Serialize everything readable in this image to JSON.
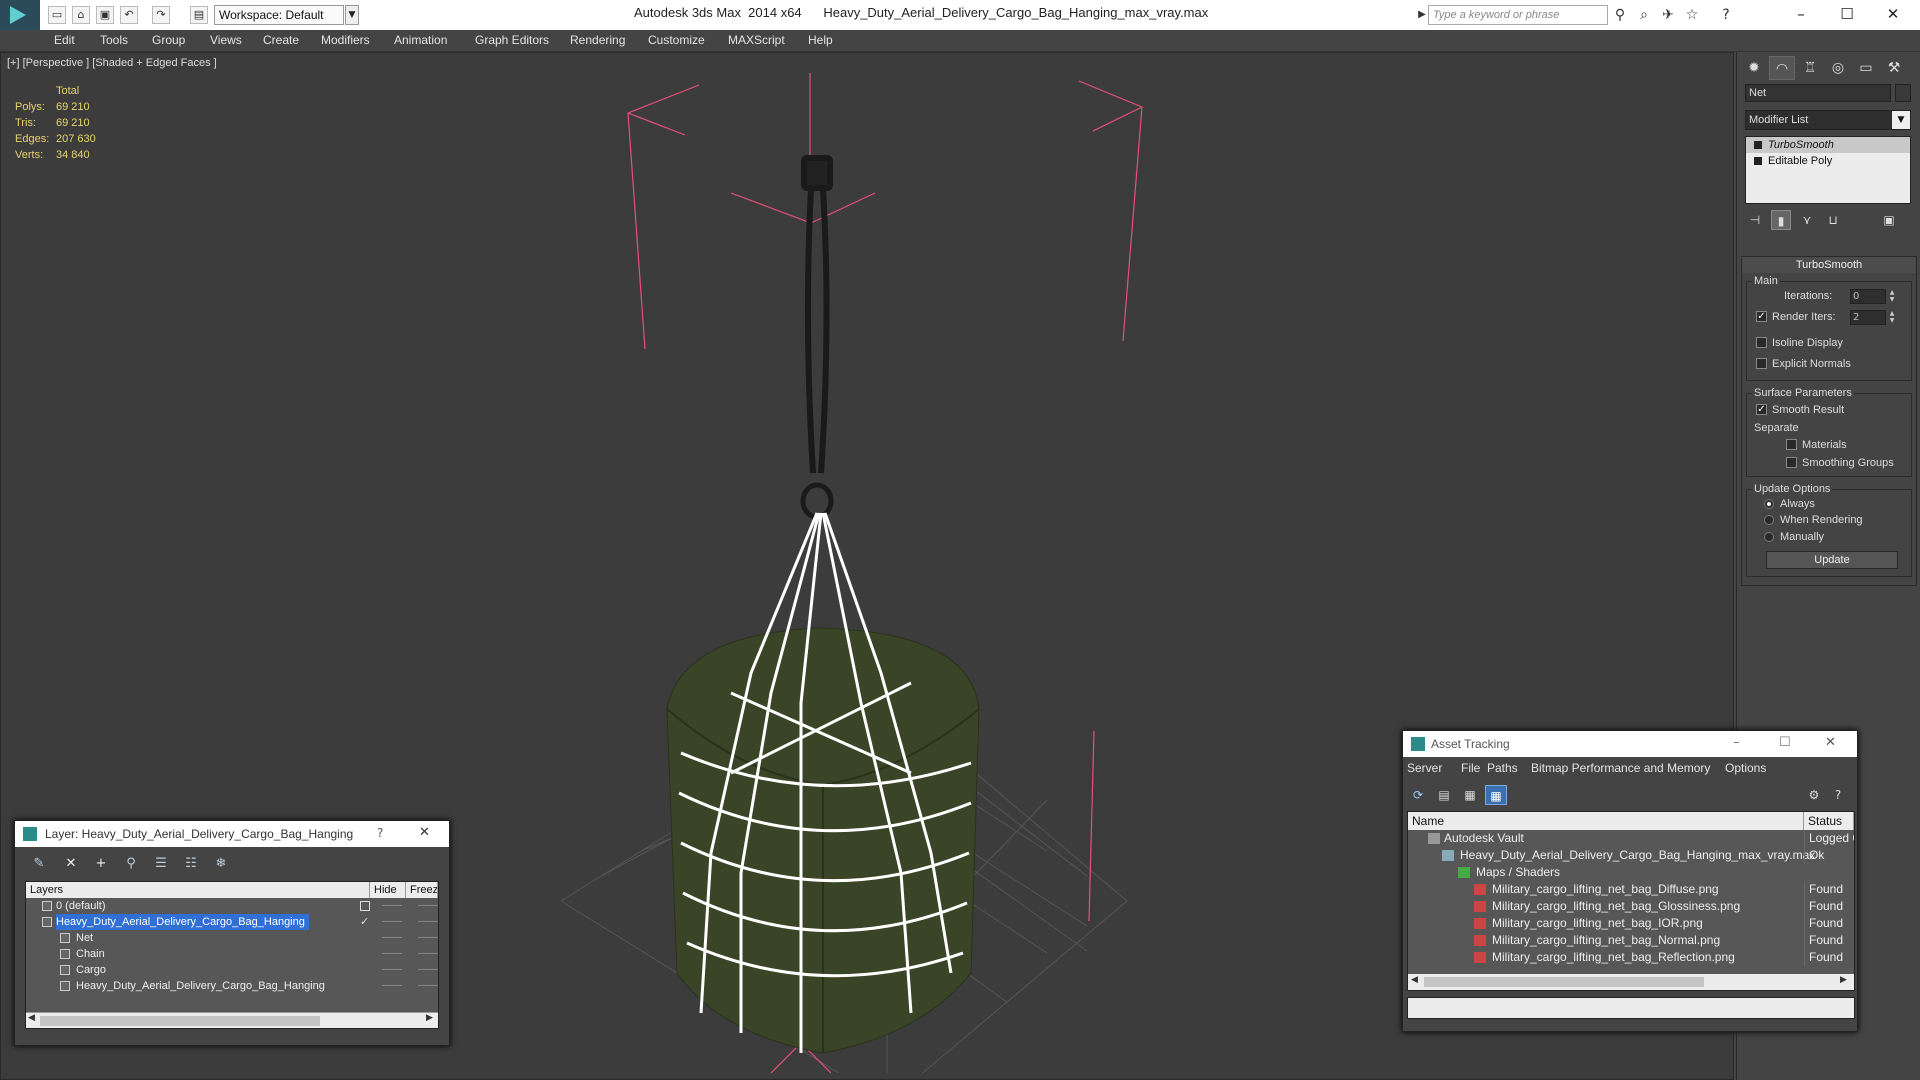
{
  "titlebar": {
    "workspace": "Workspace: Default",
    "app_title": "Autodesk 3ds Max  2014 x64",
    "file_name": "Heavy_Duty_Aerial_Delivery_Cargo_Bag_Hanging_max_vray.max",
    "search_placeholder": "Type a keyword or phrase",
    "minimize": "–",
    "maximize": "☐",
    "close": "✕"
  },
  "menubar": [
    "Edit",
    "Tools",
    "Group",
    "Views",
    "Create",
    "Modifiers",
    "Animation",
    "Graph Editors",
    "Rendering",
    "Customize",
    "MAXScript",
    "Help"
  ],
  "viewport": {
    "label": "[+] [Perspective ] [Shaded + Edged Faces ]",
    "stats": {
      "header": "Total",
      "rows": [
        {
          "key": "Polys:",
          "value": "69 210"
        },
        {
          "key": "Tris:",
          "value": "69 210"
        },
        {
          "key": "Edges:",
          "value": "207 630"
        },
        {
          "key": "Verts:",
          "value": "34 840"
        }
      ]
    }
  },
  "command_panel": {
    "object_name": "Net",
    "modifier_list": "Modifier List",
    "stack": [
      "TurboSmooth",
      "Editable Poly"
    ],
    "rollout_title": "TurboSmooth",
    "main_group": "Main",
    "iterations_label": "Iterations:",
    "iterations_value": "0",
    "render_iters_label": "Render Iters:",
    "render_iters_value": "2",
    "isoline_display": "Isoline Display",
    "explicit_normals": "Explicit Normals",
    "surface_params": "Surface Parameters",
    "smooth_result": "Smooth Result",
    "separate": "Separate",
    "materials": "Materials",
    "smoothing_groups": "Smoothing Groups",
    "update_options": "Update Options",
    "always": "Always",
    "when_rendering": "When Rendering",
    "manually": "Manually",
    "update_button": "Update"
  },
  "layer_dialog": {
    "title": "Layer: Heavy_Duty_Aerial_Delivery_Cargo_Bag_Hanging",
    "help": "?",
    "close": "✕",
    "columns": [
      "Layers",
      "Hide",
      "Freeze"
    ],
    "rows": [
      {
        "name": "0 (default)"
      },
      {
        "name": "Heavy_Duty_Aerial_Delivery_Cargo_Bag_Hanging"
      },
      {
        "name": "Net"
      },
      {
        "name": "Chain"
      },
      {
        "name": "Cargo"
      },
      {
        "name": "Heavy_Duty_Aerial_Delivery_Cargo_Bag_Hanging"
      }
    ],
    "dash": "——"
  },
  "asset_dialog": {
    "title": "Asset Tracking",
    "menus": [
      "Server",
      "File",
      "Paths",
      "Bitmap Performance and Memory",
      "Options"
    ],
    "columns": [
      "Name",
      "Status"
    ],
    "rows": [
      {
        "name": "Autodesk Vault",
        "status": "Logged Out"
      },
      {
        "name": "Heavy_Duty_Aerial_Delivery_Cargo_Bag_Hanging_max_vray.max",
        "status": "Ok"
      },
      {
        "name": "Maps / Shaders",
        "status": ""
      },
      {
        "name": "Military_cargo_lifting_net_bag_Diffuse.png",
        "status": "Found"
      },
      {
        "name": "Military_cargo_lifting_net_bag_Glossiness.png",
        "status": "Found"
      },
      {
        "name": "Military_cargo_lifting_net_bag_IOR.png",
        "status": "Found"
      },
      {
        "name": "Military_cargo_lifting_net_bag_Normal.png",
        "status": "Found"
      },
      {
        "name": "Military_cargo_lifting_net_bag_Reflection.png",
        "status": "Found"
      }
    ],
    "minimize": "–",
    "maximize": "☐",
    "close": "✕"
  },
  "colors": {
    "selection": "#2f6fd6",
    "stats_text": "#e8d26a",
    "bbox_pink": "#e8507a",
    "net_white": "#ffffff",
    "cargo_green": "#3a4528"
  }
}
